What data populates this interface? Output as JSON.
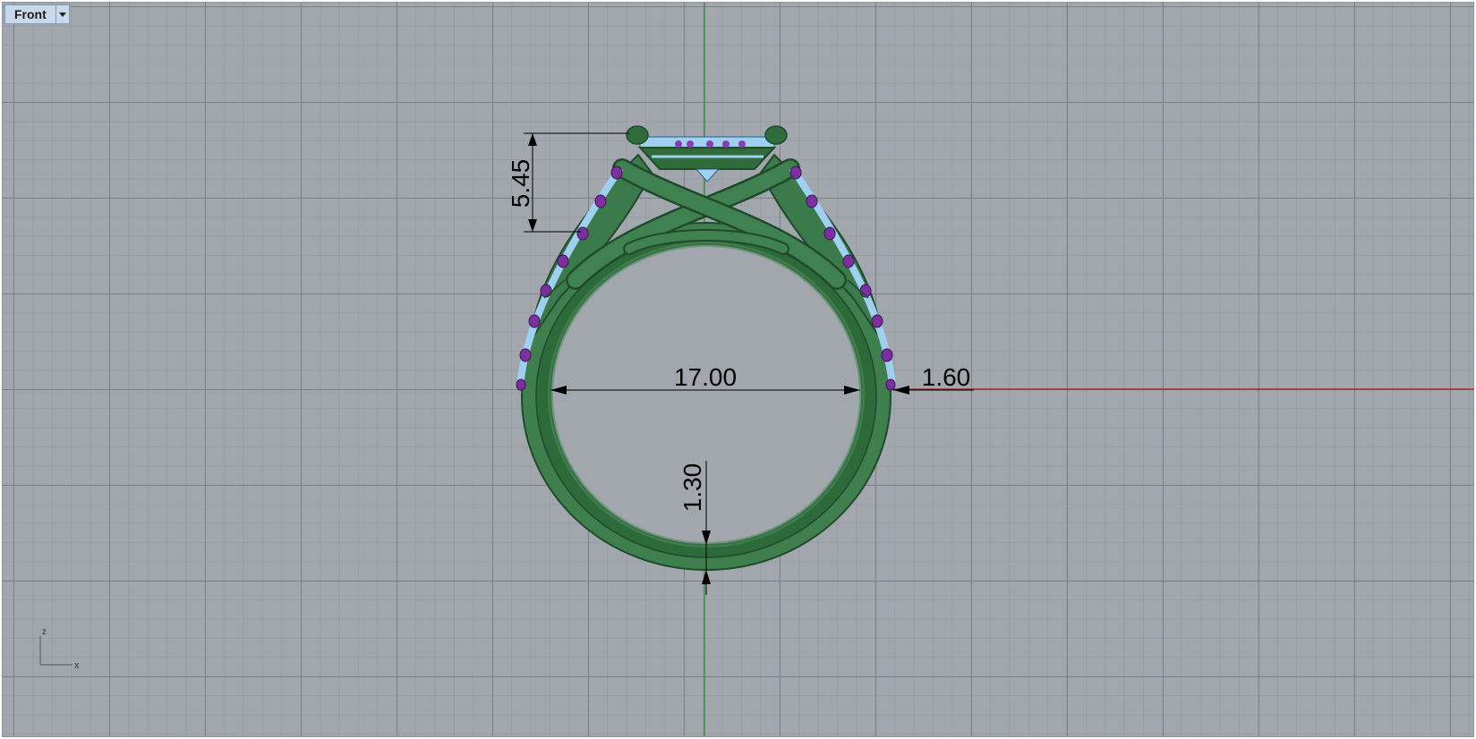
{
  "viewport": {
    "name": "Front",
    "colors": {
      "background": "#a2a7ad",
      "x_axis": "#9b1b1b",
      "z_axis": "#1e8a2a",
      "metal": "#2f6b3b",
      "stones_blue": "#9fd0f2",
      "prongs_purple": "#7b2fa0"
    }
  },
  "dimensions": {
    "head_height": "5.45",
    "inner_diameter": "17.00",
    "shank_width": "1.60",
    "shank_thickness": "1.30"
  },
  "axis_widget": {
    "vertical": "Z",
    "horizontal": "X"
  }
}
